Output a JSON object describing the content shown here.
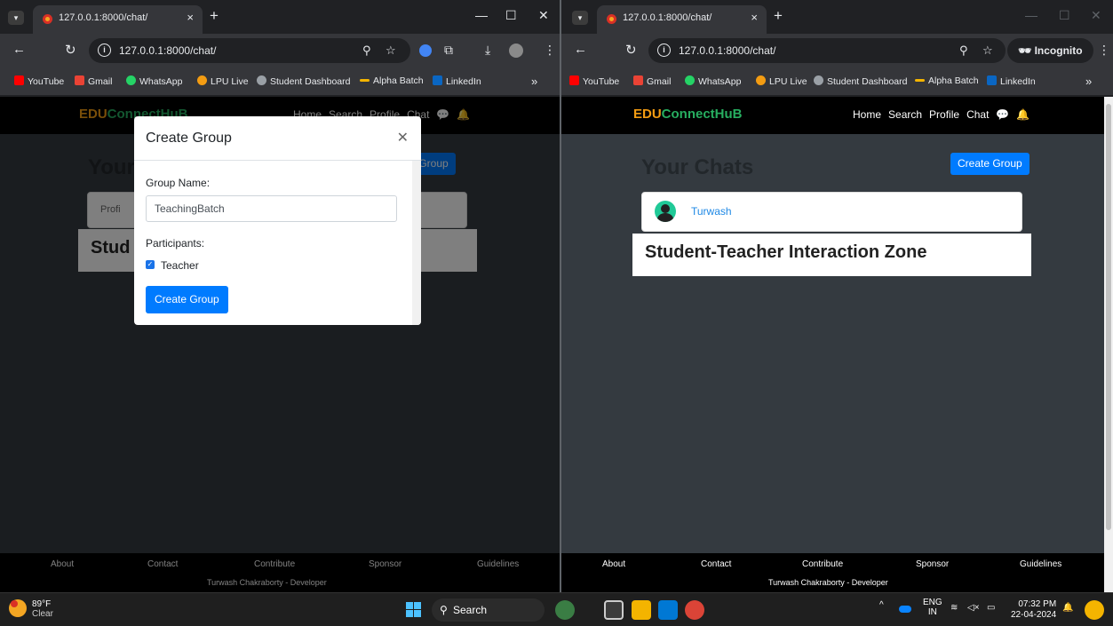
{
  "left_browser": {
    "tab_title": "127.0.0.1:8000/chat/",
    "url": "127.0.0.1:8000/chat/",
    "bookmarks": [
      "YouTube",
      "Gmail",
      "WhatsApp",
      "LPU Live",
      "Student Dashboard",
      "Alpha Batch",
      "LinkedIn"
    ]
  },
  "right_browser": {
    "tab_title": "127.0.0.1:8000/chat/",
    "url": "127.0.0.1:8000/chat/",
    "incognito_label": "Incognito",
    "bookmarks": [
      "YouTube",
      "Gmail",
      "WhatsApp",
      "LPU Live",
      "Student Dashboard",
      "Alpha Batch",
      "LinkedIn"
    ]
  },
  "site": {
    "brand_part1": "EDU",
    "brand_part2": "ConnectHuB",
    "nav": [
      "Home",
      "Search",
      "Profile",
      "Chat"
    ],
    "page_title": "Your Chats",
    "create_group_button": "Create Group",
    "chats": [
      {
        "name": "Turwash"
      }
    ],
    "left_chat_partial": "Profi",
    "left_title_partial": "Your",
    "left_zone_partial": "Stud",
    "left_create_partial": "te Group",
    "zone_title": "Student-Teacher Interaction Zone",
    "footer_links": [
      "About",
      "Contact",
      "Contribute",
      "Sponsor",
      "Guidelines"
    ],
    "footer_credit": "Turwash Chakraborty - Developer"
  },
  "modal": {
    "title": "Create Group",
    "group_name_label": "Group Name:",
    "group_name_value": "TeachingBatch",
    "participants_label": "Participants:",
    "participants": [
      {
        "name": "Teacher",
        "checked": true
      }
    ],
    "submit_label": "Create Group"
  },
  "taskbar": {
    "temperature": "89°F",
    "weather": "Clear",
    "search_label": "Search",
    "language": "ENG",
    "region": "IN",
    "time": "07:32 PM",
    "date": "22-04-2024"
  },
  "colors": {
    "brand_orange": "#f39c12",
    "brand_green": "#27ae60",
    "primary_button": "#007bff"
  }
}
